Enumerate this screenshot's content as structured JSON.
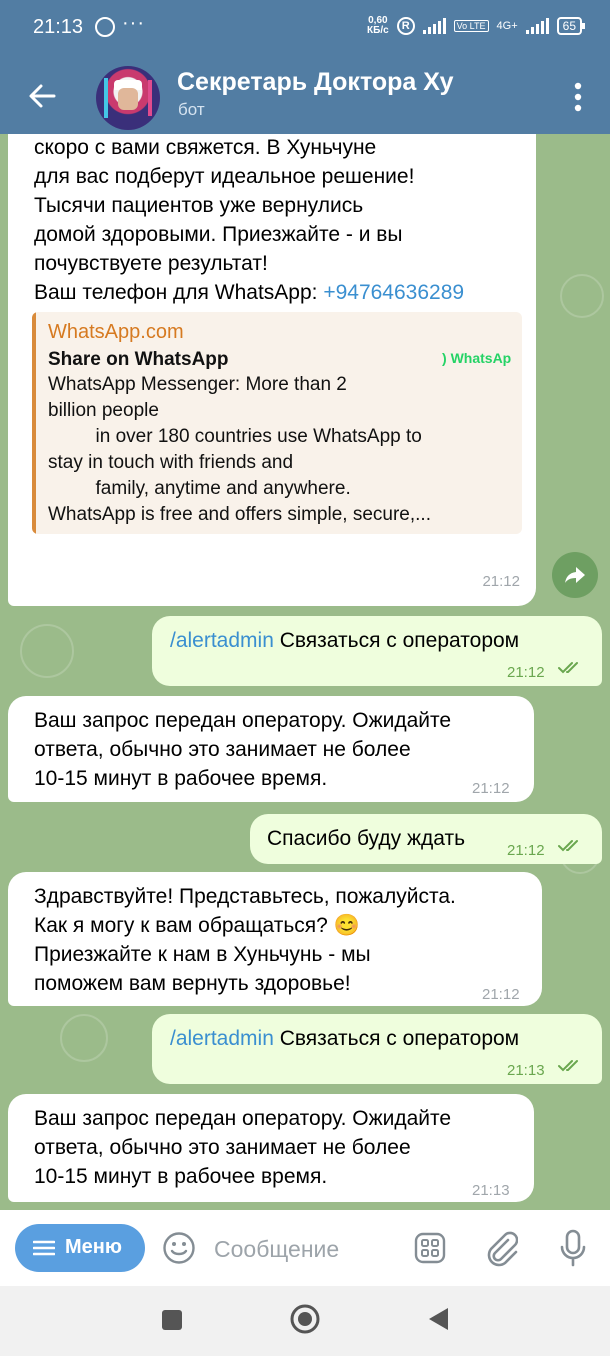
{
  "statusbar": {
    "time": "21:13",
    "dots": "···",
    "speed_top": "0,60",
    "speed_bottom": "КБ/с",
    "r_badge": "R",
    "volte": "Vo LTE",
    "net": "4G+",
    "battery": "65"
  },
  "header": {
    "title": "Секретарь Доктора Ху",
    "subtitle": "бот"
  },
  "messages": [
    {
      "text": "информацию о вашей ситуации и\nскоро с вами свяжется. В Хуньчуне\nдля вас подберут идеальное решение!\nТысячи пациентов уже вернулись\nдомой здоровыми. Приезжайте - и вы\nпочувствуете результат!",
      "phone_label": "Ваш телефон для WhatsApp: ",
      "phone": "+94764636289",
      "preview": {
        "site": "WhatsApp.com",
        "title": "Share on WhatsApp",
        "description": "WhatsApp Messenger: More than 2\nbillion people\n         in over 180 countries use WhatsApp to\nstay in touch with friends and\n         family, anytime and anywhere.\nWhatsApp is free and offers simple, secure,...",
        "logo_text": "WhatsApp"
      },
      "time": "21:12"
    },
    {
      "command": "/alertadmin",
      "text": " Связаться с оператором",
      "time": "21:12"
    },
    {
      "text": "Ваш запрос передан оператору. Ожидайте\nответа, обычно это занимает не более\n10-15 минут в рабочее время.",
      "time": "21:12"
    },
    {
      "text": "Спасибо буду ждать",
      "time": "21:12"
    },
    {
      "text": "Здравствуйте! Представьтесь, пожалуйста.\nКак я могу к вам обращаться? 😊\nПриезжайте к нам в Хуньчунь - мы\nпоможем вам вернуть здоровье!",
      "time": "21:12"
    },
    {
      "command": "/alertadmin",
      "text": " Связаться с оператором",
      "time": "21:13"
    },
    {
      "text": "Ваш запрос передан оператору. Ожидайте\nответа, обычно это занимает не более\n10-15 минут в рабочее время.",
      "time": "21:13"
    }
  ],
  "input": {
    "menu_label": "Меню",
    "placeholder": "Сообщение"
  },
  "colors": {
    "header": "#527da3",
    "chat_background": "#9bbb8a",
    "outgoing_bubble": "#effedd",
    "link": "#3a8fd0",
    "menu_button": "#5a9fe0"
  }
}
